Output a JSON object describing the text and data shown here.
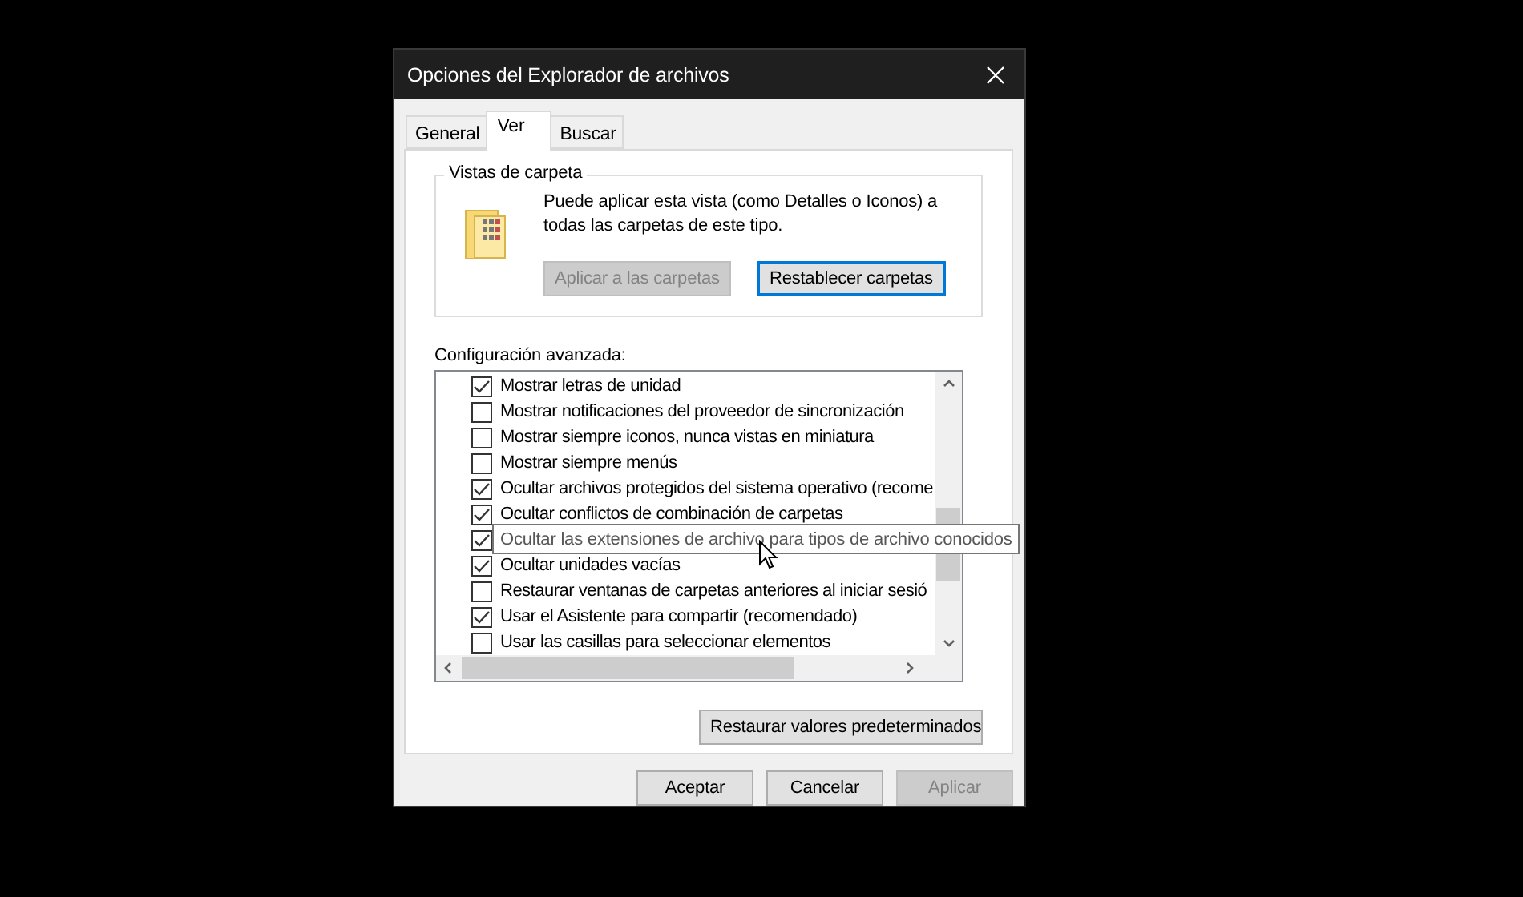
{
  "window": {
    "title": "Opciones del Explorador de archivos"
  },
  "tabs": [
    {
      "label": "General",
      "selected": false
    },
    {
      "label": "Ver",
      "selected": true
    },
    {
      "label": "Buscar",
      "selected": false
    }
  ],
  "folder_views": {
    "title": "Vistas de carpeta",
    "description": "Puede aplicar esta vista (como Detalles o Iconos) a todas las carpetas de este tipo.",
    "buttons": [
      {
        "label": "Aplicar a las carpetas",
        "disabled": true,
        "focused": false
      },
      {
        "label": "Restablecer carpetas",
        "disabled": false,
        "focused": true
      }
    ]
  },
  "advanced": {
    "label": "Configuración avanzada:",
    "items": [
      {
        "label": "Mostrar letras de unidad",
        "checked": true
      },
      {
        "label": "Mostrar notificaciones del proveedor de sincronización",
        "checked": false
      },
      {
        "label": "Mostrar siempre iconos, nunca vistas en miniatura",
        "checked": false
      },
      {
        "label": "Mostrar siempre menús",
        "checked": false
      },
      {
        "label": "Ocultar archivos protegidos del sistema operativo (recome",
        "checked": true
      },
      {
        "label": "Ocultar conflictos de combinación de carpetas",
        "checked": true
      },
      {
        "checked": true,
        "tooltip": "Ocultar las extensiones de archivo para tipos de archivo conocidos"
      },
      {
        "label": "Ocultar unidades vacías",
        "checked": true
      },
      {
        "label": "Restaurar ventanas de carpetas anteriores al iniciar sesió",
        "checked": false
      },
      {
        "label": "Usar el Asistente para compartir (recomendado)",
        "checked": true
      },
      {
        "label": "Usar las casillas para seleccionar elementos",
        "checked": false
      }
    ],
    "restore_button": "Restaurar valores predeterminados"
  },
  "buttons": [
    {
      "label": "Aceptar",
      "disabled": false
    },
    {
      "label": "Cancelar",
      "disabled": false
    },
    {
      "label": "Aplicar",
      "disabled": true
    }
  ]
}
